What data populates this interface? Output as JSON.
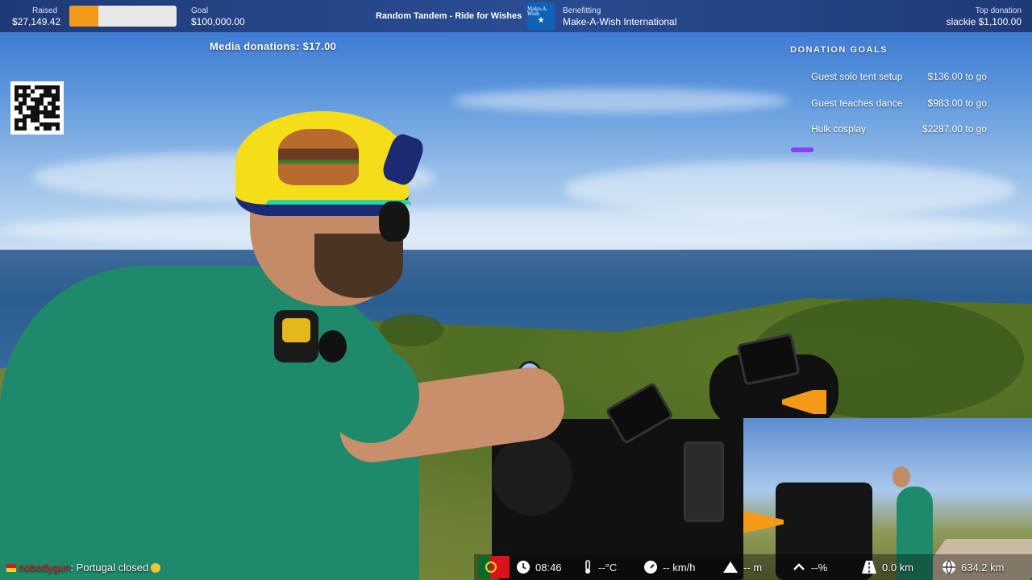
{
  "topbar": {
    "raised_label": "Raised",
    "raised_value": "$27,149.42",
    "progress_fraction": 0.27,
    "goal_label": "Goal",
    "goal_value": "$100,000.00",
    "event_title": "Random Tandem - Ride for Wishes",
    "benefitting_label": "Benefitting",
    "charity_name": "Make-A-Wish International",
    "charity_logo_text": "Make-A-Wish",
    "top_donation_label": "Top donation",
    "top_donation_value": "slackie $1,100.00"
  },
  "media_donations": "Media donations: $17.00",
  "qr_icon": "qr-code-icon",
  "goals": {
    "title": "DONATION GOALS",
    "items": [
      {
        "name": "Guest solo tent setup",
        "amount": "$136.00 to go"
      },
      {
        "name": "Guest teaches dance",
        "amount": "$983.00 to go"
      },
      {
        "name": "Hulk cosplay",
        "amount": "$2287.00 to go"
      }
    ],
    "accent_color": "#8a3ff0"
  },
  "chat": {
    "username": "nobodygun",
    "message": "Portugal closed"
  },
  "stats": {
    "time": "08:46",
    "temperature": "--°C",
    "speed": "-- km/h",
    "elevation": "-- m",
    "grade": "--%",
    "distance_today": "0.0 km",
    "distance_total": "634.2 km"
  },
  "colors": {
    "topbar": "#2a4c92",
    "progress": "#f39a18"
  }
}
